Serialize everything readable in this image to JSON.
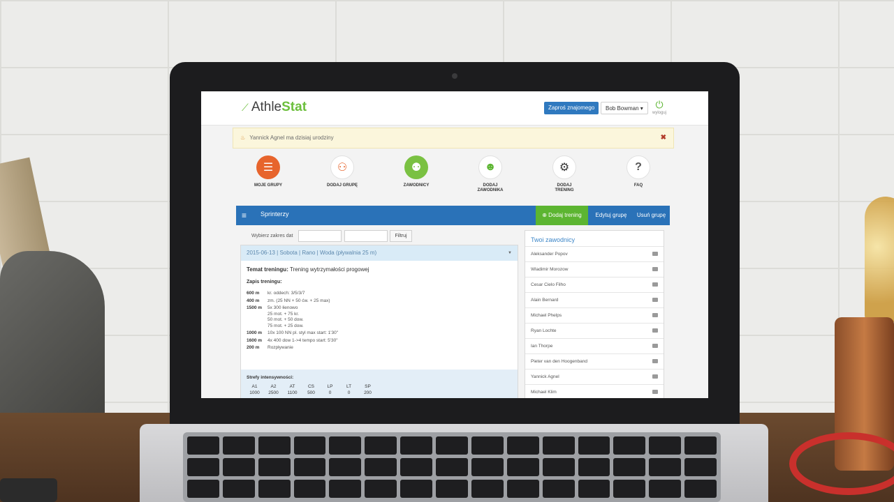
{
  "header": {
    "logo_athle": "Athle",
    "logo_stat": "Stat",
    "invite_label": "Zaproś znajomego",
    "user_label": "Bob Bowman ▾",
    "logout_label": "wyloguj"
  },
  "alert": {
    "text": "Yannick Agnel ma dzisiaj urodziny",
    "close": "✖"
  },
  "nav": [
    {
      "label": "MOJE GRUPY",
      "icon": "notebook-icon"
    },
    {
      "label": "DODAJ GRUPĘ",
      "icon": "add-group-icon"
    },
    {
      "label": "ZAWODNICY",
      "icon": "people-icon"
    },
    {
      "label": "DODAJ ZAWODNIKA",
      "icon": "add-user-icon"
    },
    {
      "label": "DODAJ TRENING",
      "icon": "gears-icon"
    },
    {
      "label": "FAQ",
      "icon": "question-icon"
    }
  ],
  "panel": {
    "title": "Sprinterzy",
    "add_training": "Dodaj trening",
    "edit_group": "Edytuj grupę",
    "delete_group": "Usuń grupę"
  },
  "filter": {
    "label": "Wybierz zakres dat",
    "button": "Filtruj"
  },
  "training": {
    "header": "2015-06-13 | Sobota | Rano | Woda (pływalnia 25 m)",
    "topic_label": "Temat treningu:",
    "topic_value": "Trening wytrzymałości progowej",
    "log_label": "Zapis treningu:",
    "rows": [
      {
        "dist": "600 m",
        "desc": "kr. oddech: 3/5/3/7"
      },
      {
        "dist": "400 m",
        "desc": "zm. (25 NN + 50 ćw. + 25 max)"
      },
      {
        "dist": "1500 m",
        "desc": "5x 300 łienowo\n25 mot. + 75 kr.\n50 mot. + 50 dow.\n75 mot. + 25 dow."
      },
      {
        "dist": "1000 m",
        "desc": "10x 100 NN pl. styl max start: 1'30\""
      },
      {
        "dist": "1600 m",
        "desc": "4x 400 dow 1->4 tempo start: 5'30\""
      },
      {
        "dist": "200 m",
        "desc": "Rozpływanie"
      }
    ],
    "zones_label": "Strefy intensywności:",
    "zones_headers": [
      "A1",
      "A2",
      "AT",
      "CS",
      "LP",
      "LT",
      "SP"
    ],
    "zones_values": [
      "1000",
      "2500",
      "1100",
      "500",
      "0",
      "0",
      "200"
    ]
  },
  "athletes": {
    "title": "Twoi zawodnicy",
    "list": [
      "Aleksander Popov",
      "Wladimir Morozow",
      "Cesar Cielo Filho",
      "Alain Bernard",
      "Michael Phelps",
      "Ryan Lochte",
      "Ian Thorpe",
      "Pieter van den Hoogenband",
      "Yannick Agnel",
      "Michael Klim"
    ]
  }
}
